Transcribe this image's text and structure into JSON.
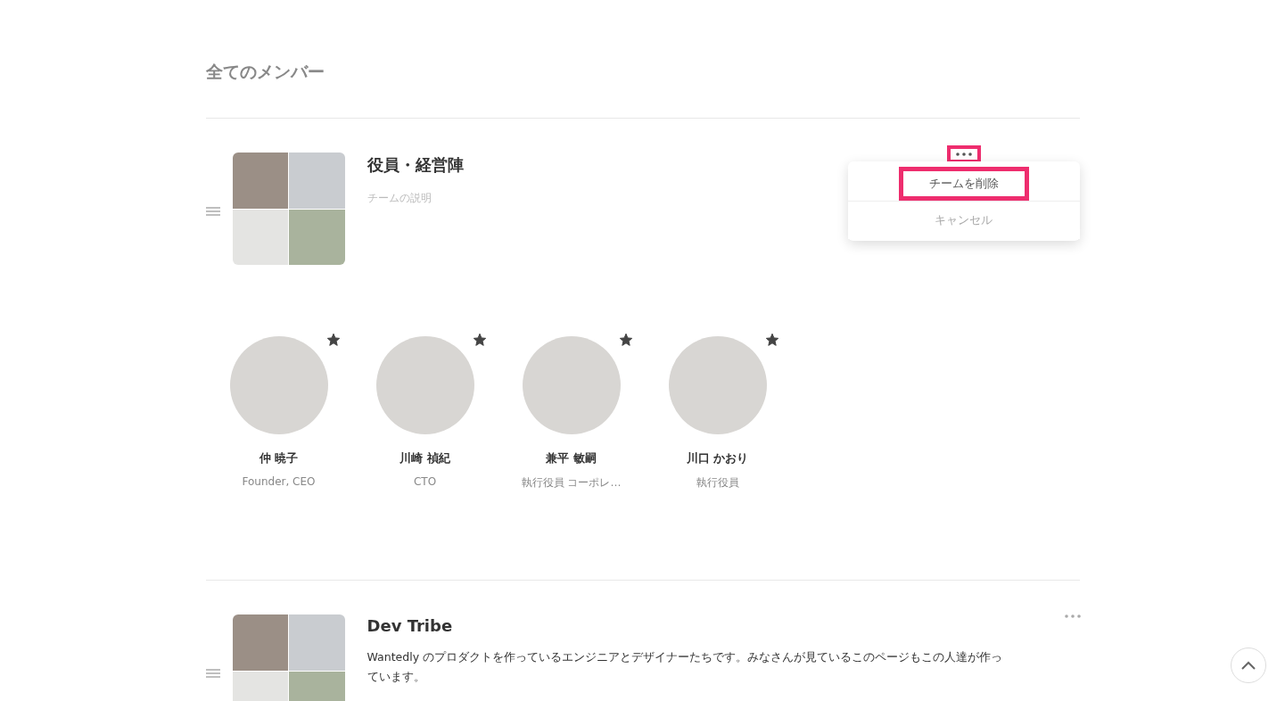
{
  "page_title": "全てのメンバー",
  "teams": [
    {
      "name": "役員・経営陣",
      "description": "チームの説明",
      "description_placeholder": true,
      "menu_open": true,
      "more_highlighted": true,
      "menu": [
        {
          "label": "チームを削除",
          "kind": "danger",
          "highlighted": true
        },
        {
          "label": "キャンセル",
          "kind": "cancel",
          "highlighted": false
        }
      ],
      "members": [
        {
          "name": "仲 暁子",
          "role": "Founder, CEO",
          "starred": true
        },
        {
          "name": "川崎 禎紀",
          "role": "CTO",
          "starred": true
        },
        {
          "name": "兼平 敏嗣",
          "role": "執行役員 コーポレ…",
          "starred": true
        },
        {
          "name": "川口 かおり",
          "role": "執行役員",
          "starred": true
        }
      ]
    },
    {
      "name": "Dev Tribe",
      "description": "Wantedly のプロダクトを作っているエンジニアとデザイナーたちです。みなさんが見ているこのページもこの人達が作っています。",
      "description_placeholder": false,
      "menu_open": false,
      "more_highlighted": false
    }
  ]
}
